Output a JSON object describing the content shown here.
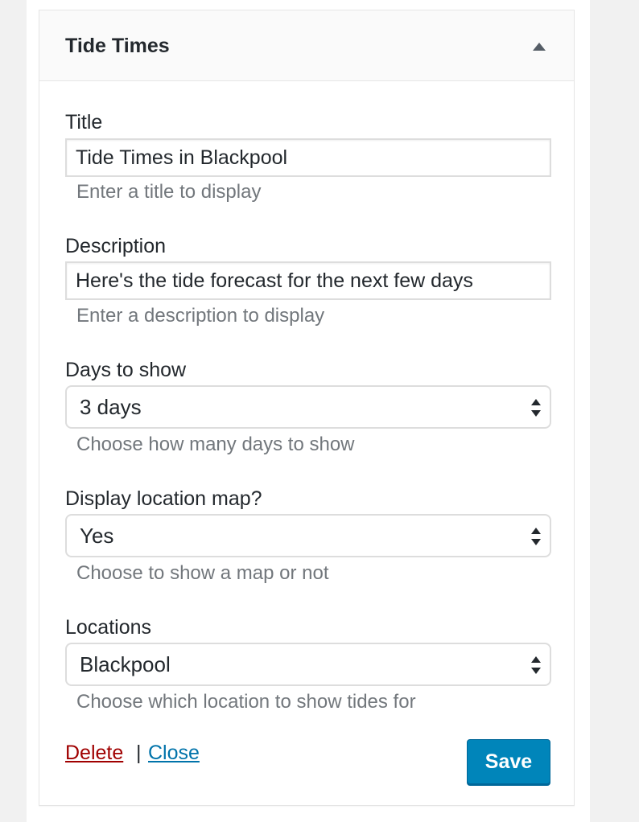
{
  "widget": {
    "title": "Tide Times",
    "toggle_icon": "triangle-up-icon"
  },
  "fields": {
    "title": {
      "label": "Title",
      "value": "Tide Times in Blackpool",
      "help": "Enter a title to display"
    },
    "description": {
      "label": "Description",
      "value": "Here's the tide forecast for the next few days",
      "help": "Enter a description to display"
    },
    "days": {
      "label": "Days to show",
      "selected": "3 days",
      "help": "Choose how many days to show"
    },
    "map": {
      "label": "Display location map?",
      "selected": "Yes",
      "help": "Choose to show a map or not"
    },
    "locations": {
      "label": "Locations",
      "selected": "Blackpool",
      "help": "Choose which location to show tides for"
    }
  },
  "actions": {
    "delete_label": "Delete",
    "separator": "|",
    "close_label": "Close",
    "save_label": "Save"
  },
  "colors": {
    "delete_link": "#a00000",
    "close_link": "#0073aa",
    "save_button": "#0085ba"
  }
}
